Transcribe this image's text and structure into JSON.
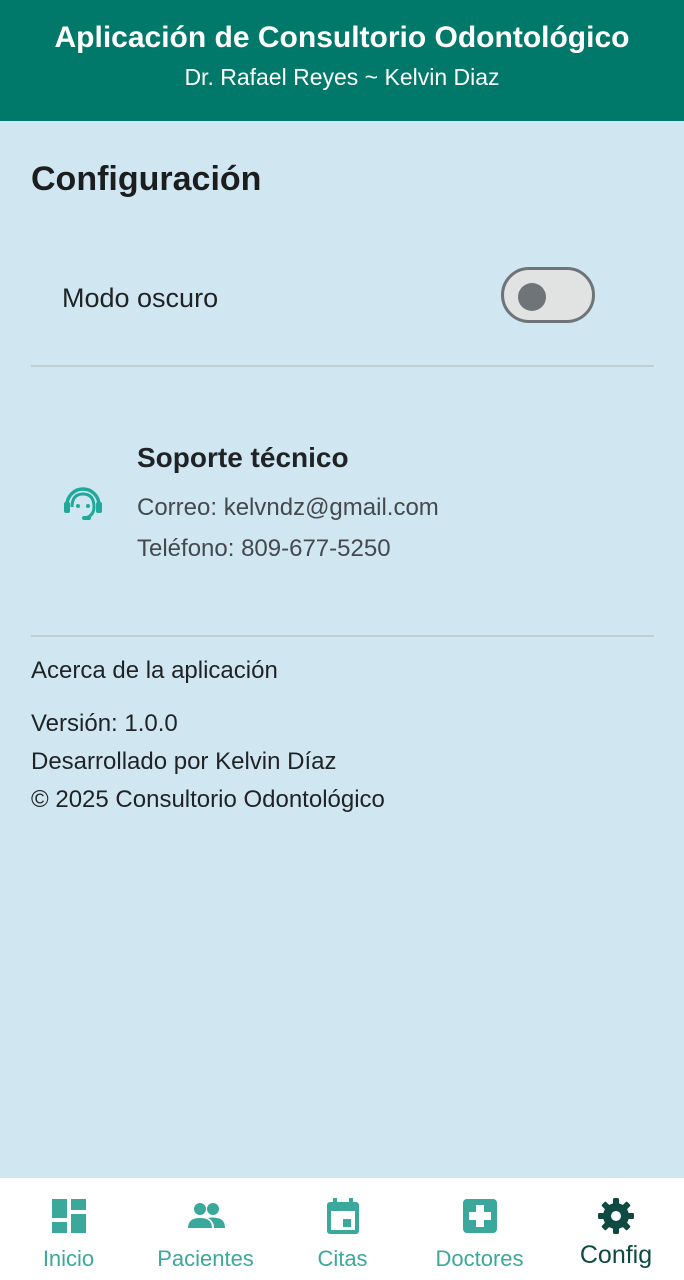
{
  "header": {
    "title": "Aplicación de Consultorio Odontológico",
    "subtitle": "Dr. Rafael Reyes ~ Kelvin Diaz"
  },
  "page": {
    "title": "Configuración"
  },
  "settings": {
    "dark_mode_label": "Modo oscuro",
    "dark_mode_enabled": false
  },
  "support": {
    "icon": "support-agent-icon",
    "title": "Soporte técnico",
    "email_line": "Correo: kelvndz@gmail.com",
    "phone_line": "Teléfono: 809-677-5250"
  },
  "about": {
    "title": "Acerca de la aplicación",
    "version": "Versión: 1.0.0",
    "developer": "Desarrollado por Kelvin Díaz",
    "copyright": "© 2025 Consultorio Odontológico"
  },
  "nav": {
    "active": "Config",
    "items": [
      {
        "label": "Inicio",
        "icon": "dashboard-icon"
      },
      {
        "label": "Pacientes",
        "icon": "people-icon"
      },
      {
        "label": "Citas",
        "icon": "calendar-icon"
      },
      {
        "label": "Doctores",
        "icon": "medical-cross-icon"
      },
      {
        "label": "Config",
        "icon": "gear-icon"
      }
    ]
  },
  "colors": {
    "header_bg": "#00786a",
    "page_bg": "#d0e7f2",
    "accent": "#3aa99b",
    "active_nav": "#0f4a42"
  }
}
